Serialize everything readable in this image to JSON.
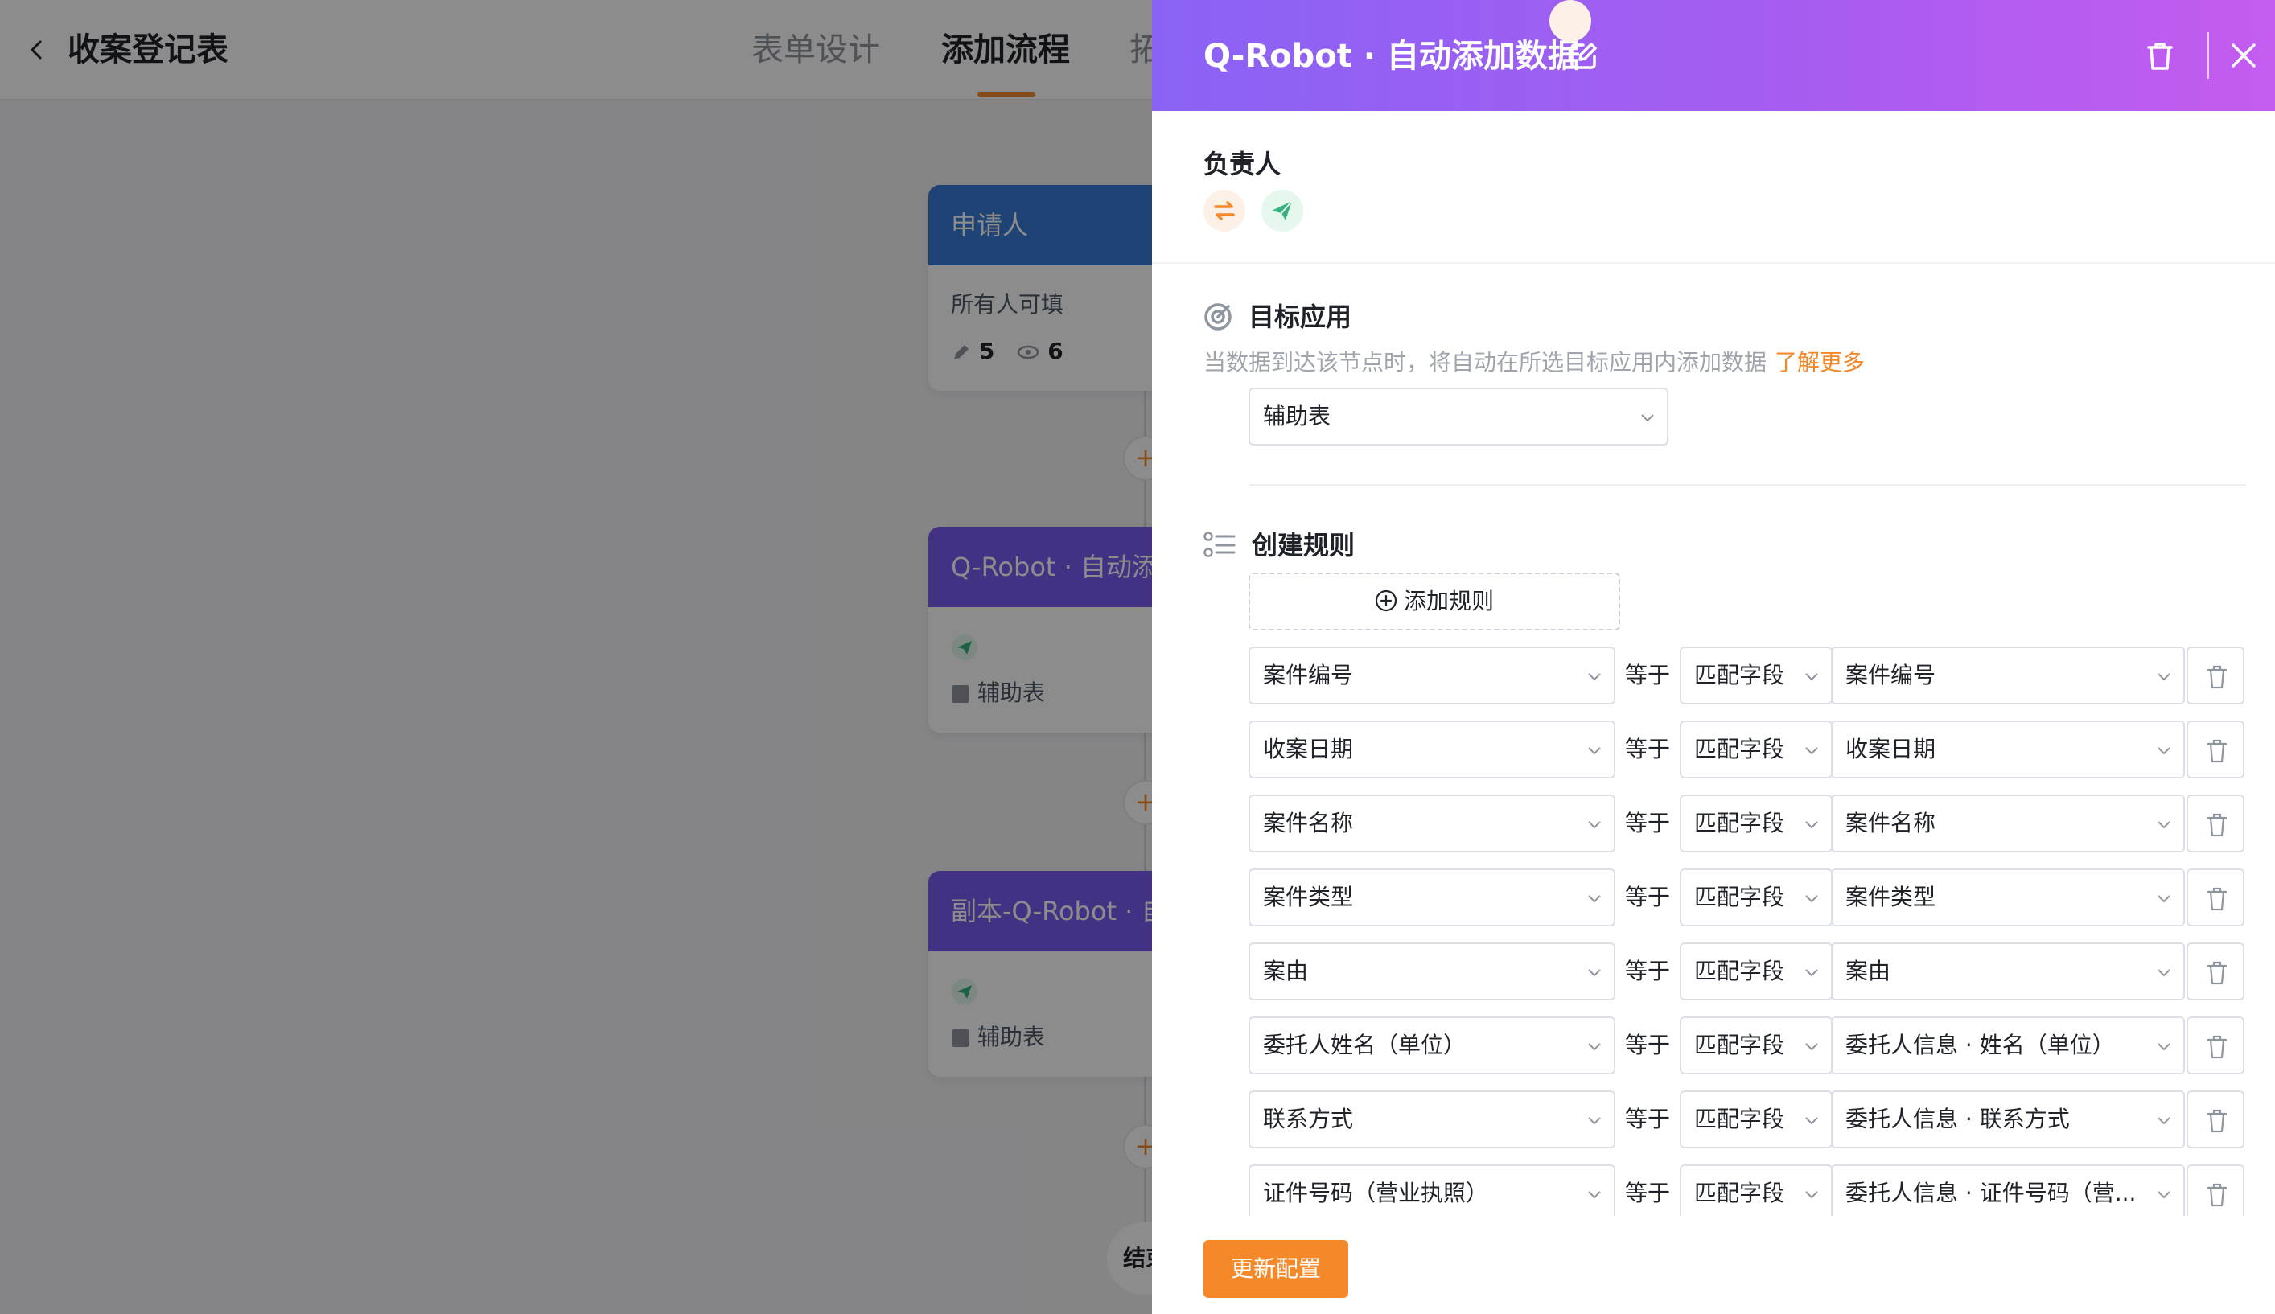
{
  "app": {
    "title": "收案登记表",
    "tabs": [
      {
        "label": "表单设计",
        "active": false
      },
      {
        "label": "添加流程",
        "active": true
      },
      {
        "label": "拓",
        "active": false
      }
    ],
    "nodes": [
      {
        "title": "申请人",
        "subtitle": "所有人可填",
        "edit_count": "5",
        "view_count": "6"
      },
      {
        "title": "Q-Robot · 自动添",
        "target": "辅助表"
      },
      {
        "title": "副本-Q-Robot · 自",
        "target": "辅助表"
      }
    ],
    "end_label": "结束"
  },
  "drawer": {
    "title": "Q-Robot · 自动添加数据",
    "owner_label": "负责人",
    "target_app": {
      "label": "目标应用",
      "hint": "当数据到达该节点时，将自动在所选目标应用内添加数据",
      "link": "了解更多",
      "selected": "辅助表"
    },
    "rules": {
      "label": "创建规则",
      "add_label": "添加规则",
      "equals_label": "等于",
      "items": [
        {
          "field": "案件编号",
          "mode": "匹配字段",
          "source": "案件编号"
        },
        {
          "field": "收案日期",
          "mode": "匹配字段",
          "source": "收案日期"
        },
        {
          "field": "案件名称",
          "mode": "匹配字段",
          "source": "案件名称"
        },
        {
          "field": "案件类型",
          "mode": "匹配字段",
          "source": "案件类型"
        },
        {
          "field": "案由",
          "mode": "匹配字段",
          "source": "案由"
        },
        {
          "field": "委托人姓名（单位）",
          "mode": "匹配字段",
          "source": "委托人信息 · 姓名（单位）"
        },
        {
          "field": "联系方式",
          "mode": "匹配字段",
          "source": "委托人信息 · 联系方式"
        },
        {
          "field": "证件号码（营业执照）",
          "mode": "匹配字段",
          "source": "委托人信息 · 证件号码（营..."
        }
      ]
    },
    "submit_label": "更新配置"
  },
  "colors": {
    "accent": "#f5892a",
    "header_gradient_start": "#8a63f5",
    "header_gradient_end": "#c45cf0",
    "applicant_node": "#3a7bd5",
    "robot_node": "#7b5cf0"
  }
}
